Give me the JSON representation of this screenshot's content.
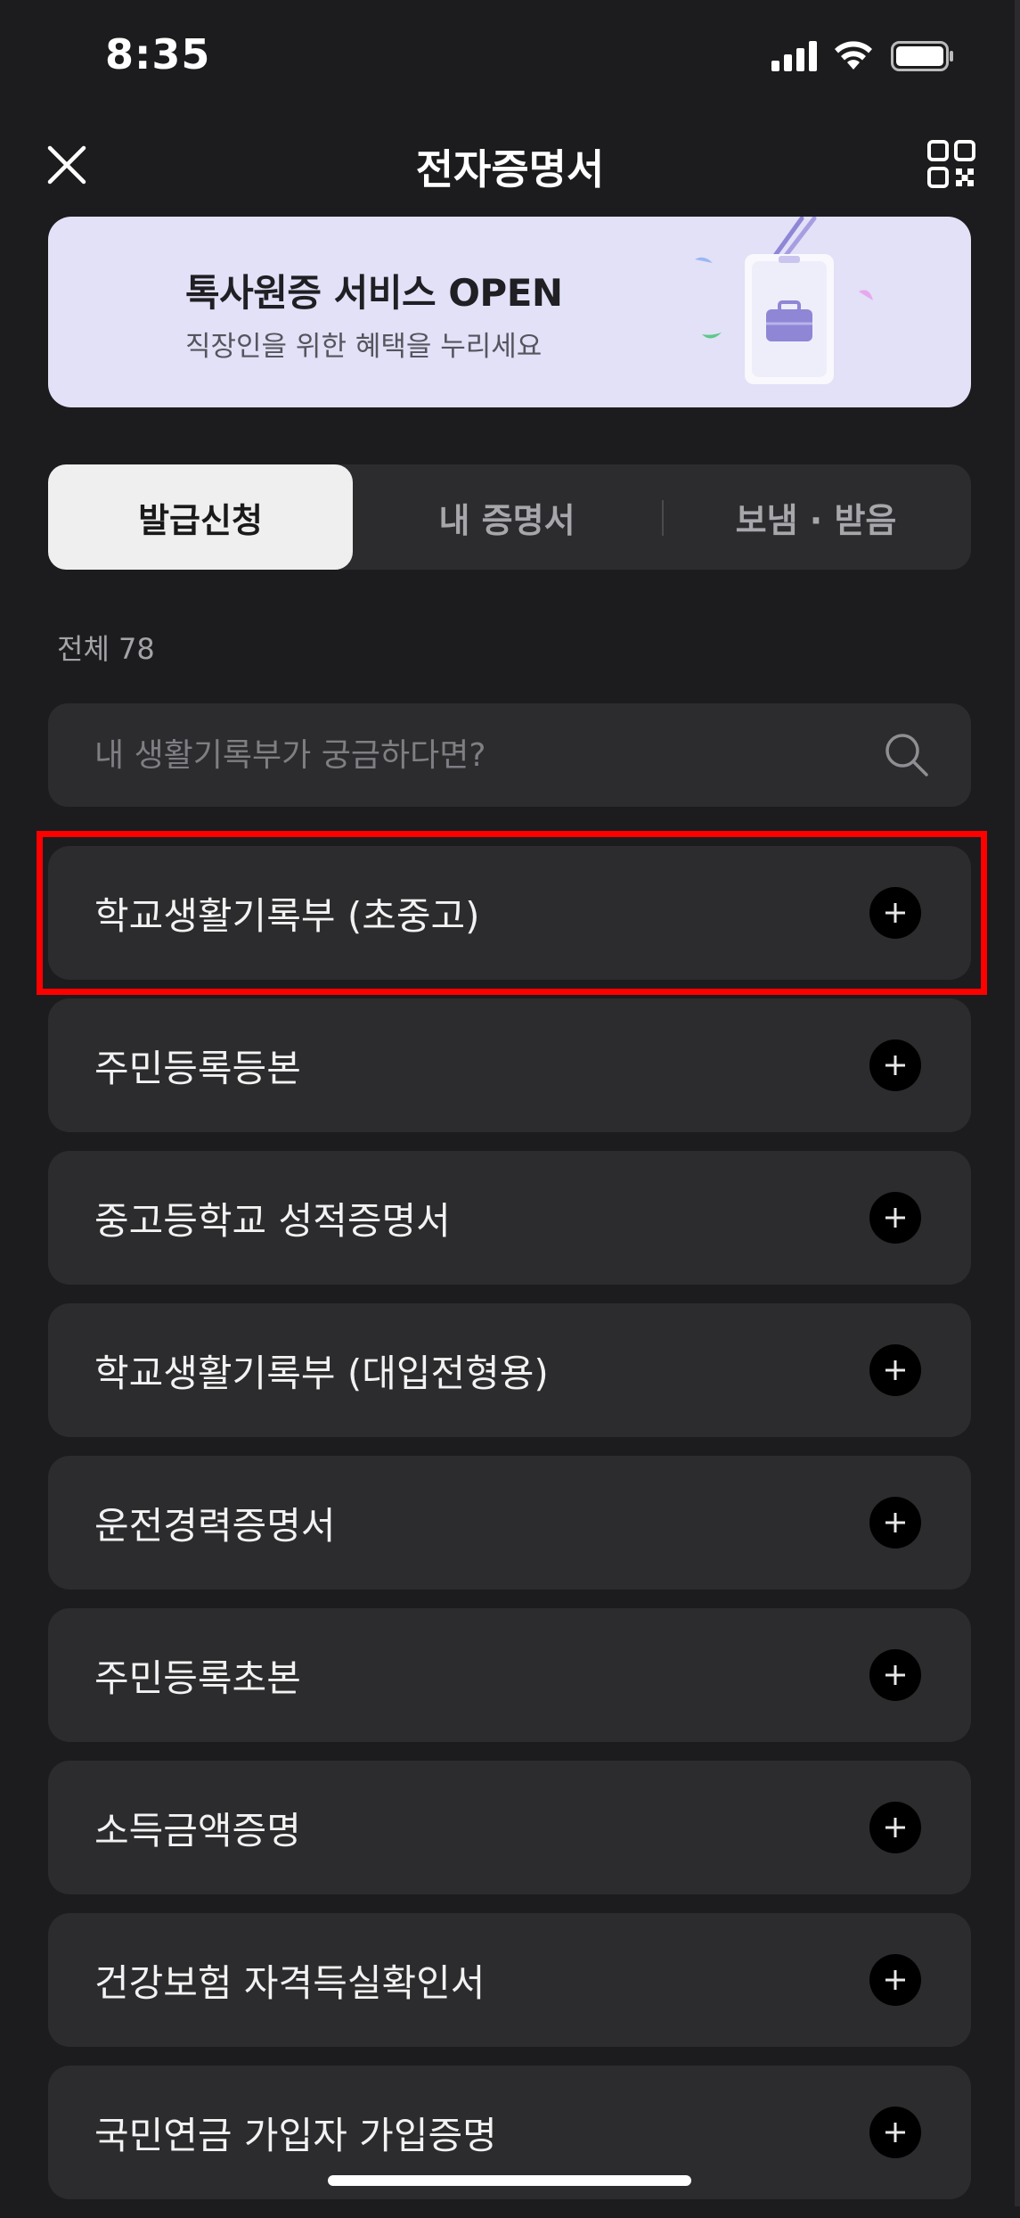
{
  "status_bar": {
    "time": "8:35",
    "icons": [
      "signal-icon",
      "wifi-icon",
      "battery-icon"
    ]
  },
  "header": {
    "title": "전자증명서",
    "left_icon": "close-icon",
    "right_icon": "qr-code-icon"
  },
  "banner": {
    "title": "톡사원증 서비스 OPEN",
    "subtitle": "직장인을 위한 혜택을 누리세요",
    "background": "#e2e1f7"
  },
  "tabs": [
    {
      "label": "발급신청",
      "active": true
    },
    {
      "label": "내 증명서",
      "active": false
    },
    {
      "label": "보냄 · 받음",
      "active": false
    }
  ],
  "list": {
    "count_label": "전체 78"
  },
  "search": {
    "placeholder": "내 생활기록부가 궁금하다면?",
    "icon": "search-icon"
  },
  "certificates": [
    {
      "label": "학교생활기록부 (초중고)"
    },
    {
      "label": "주민등록등본"
    },
    {
      "label": "중고등학교 성적증명서"
    },
    {
      "label": "학교생활기록부 (대입전형용)"
    },
    {
      "label": "운전경력증명서"
    },
    {
      "label": "주민등록초본"
    },
    {
      "label": "소득금액증명"
    },
    {
      "label": "건강보험 자격득실확인서"
    },
    {
      "label": "국민연금 가입자 가입증명"
    }
  ],
  "colors": {
    "background": "#1c1c1e",
    "card": "#2c2c2e",
    "highlight": "#ff0000",
    "banner": "#e2e1f7",
    "badge_accent": "#8f86d6"
  }
}
